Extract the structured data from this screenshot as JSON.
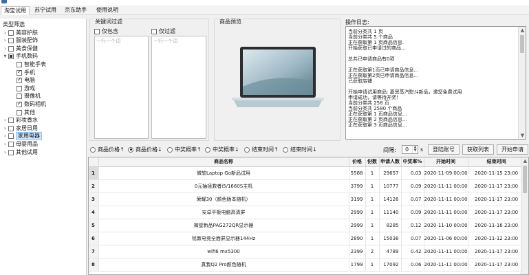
{
  "window": {
    "title": ""
  },
  "menu": {
    "tabs": [
      "淘宝试用",
      "苏宁试用",
      "京东助手",
      "使用说明"
    ]
  },
  "sidebar": {
    "title": "类型筛选",
    "items": [
      {
        "label": "美容护肤",
        "level": 0,
        "expander": ">",
        "state": "unchecked"
      },
      {
        "label": "服装配饰",
        "level": 0,
        "expander": ">",
        "state": "unchecked"
      },
      {
        "label": "美食保健",
        "level": 0,
        "expander": ">",
        "state": "unchecked"
      },
      {
        "label": "手机数码",
        "level": 0,
        "expander": "v",
        "state": "partial"
      },
      {
        "label": "智能手表",
        "level": 1,
        "expander": "",
        "state": "unchecked"
      },
      {
        "label": "手机",
        "level": 1,
        "expander": "",
        "state": "checked"
      },
      {
        "label": "电脑",
        "level": 1,
        "expander": "",
        "state": "checked"
      },
      {
        "label": "游戏",
        "level": 1,
        "expander": "",
        "state": "unchecked"
      },
      {
        "label": "摄像机",
        "level": 1,
        "expander": "",
        "state": "unchecked"
      },
      {
        "label": "数码相机",
        "level": 1,
        "expander": "",
        "state": "checked"
      },
      {
        "label": "其他",
        "level": 1,
        "expander": "",
        "state": "unchecked"
      },
      {
        "label": "彩妆香水",
        "level": 0,
        "expander": ">",
        "state": "unchecked"
      },
      {
        "label": "家居日用",
        "level": 0,
        "expander": ">",
        "state": "unchecked"
      },
      {
        "label": "家用电器",
        "level": 0,
        "expander": ">",
        "state": "unchecked",
        "selected": true
      },
      {
        "label": "母婴用品",
        "level": 0,
        "expander": ">",
        "state": "unchecked"
      },
      {
        "label": "其他试用",
        "level": 0,
        "expander": ">",
        "state": "unchecked"
      }
    ]
  },
  "filter": {
    "title": "关键词过滤",
    "include_label": "仅包含",
    "exclude_label": "仅过滤",
    "include_placeholder": "一行一个词",
    "exclude_placeholder": "一行一个词"
  },
  "preview": {
    "title": "商品预览"
  },
  "log": {
    "title": "操作日志:",
    "lines": [
      "当前分类共 1 页",
      "当前分类共 5 个商品",
      "正在获取第 1 页商品信息.",
      "开始获取已申请过的商品...",
      "",
      "总共已申请商品有0项",
      "",
      "正在获取第1页已申请商品信息...",
      "正在获取第2页已申请商品信息...",
      "已获取店铺",
      "",
      "开始申请试用商品: 嘉思蒸汽熨斗新品，邀您免费试用",
      "申请成功，请等待开奖！",
      "当前分类共 258 页",
      "当前分类共 2580 个商品",
      "正在获取第 1 页商品信息...",
      "正在获取第 2 页商品信息...",
      "正在获取第 3 页商品信息..."
    ]
  },
  "sort": {
    "options": [
      "商品价格↑",
      "商品价格↓",
      "中奖概率↑",
      "中奖概率↓",
      "结束时间↑",
      "结束时间↓"
    ],
    "selected_index": 1,
    "interval_label": "间隔:",
    "interval_value": "0",
    "interval_unit": "s",
    "buttons": {
      "tag": "登陆账号",
      "fetch": "获取列表",
      "apply": "开始申请"
    }
  },
  "table": {
    "columns": [
      "商品名称",
      "价格",
      "份数",
      "申请人数",
      "中奖率%",
      "开始时间",
      "结束时间"
    ],
    "rows": [
      {
        "n": "1",
        "name": "微软Laptop Go新品试用",
        "price": "5588",
        "qty": "1",
        "applicants": "29657",
        "rate": "0.03",
        "start": "2020-11-09 00:00",
        "end": "2020-11-15 23:00"
      },
      {
        "n": "2",
        "name": "0元抽拯救者i5/1660S主机",
        "price": "3799",
        "qty": "1",
        "applicants": "10777",
        "rate": "0.09",
        "start": "2020-11-11 00:00",
        "end": "2020-11-17 23:00"
      },
      {
        "n": "3",
        "name": "荣耀30（颜色版本随机）",
        "price": "3199",
        "qty": "1",
        "applicants": "14126",
        "rate": "0.07",
        "start": "2020-11-11 00:00",
        "end": "2020-11-17 23:00"
      },
      {
        "n": "4",
        "name": "安卓平板电脑高清屏",
        "price": "2999",
        "qty": "1",
        "applicants": "11140",
        "rate": "0.09",
        "start": "2020-11-11 00:00",
        "end": "2020-11-17 23:00"
      },
      {
        "n": "5",
        "name": "微星新品PAG272QR显示器",
        "price": "2999",
        "qty": "1",
        "applicants": "8285",
        "rate": "0.12",
        "start": "2020-11-10 00:00",
        "end": "2020-11-16 23:00"
      },
      {
        "n": "6",
        "name": "铭敦电竞全面屏显示器144Hz",
        "price": "2890",
        "qty": "1",
        "applicants": "15038",
        "rate": "0.07",
        "start": "2020-11-06 00:00",
        "end": "2020-11-12 23:00"
      },
      {
        "n": "7",
        "name": "wifi6 mx5300",
        "price": "2399",
        "qty": "2",
        "applicants": "4789",
        "rate": "0.42",
        "start": "2020-11-11 00:00",
        "end": "2020-11-17 23:00"
      },
      {
        "n": "8",
        "name": "真我Q2 Pro颜色随机",
        "price": "1799",
        "qty": "1",
        "applicants": "17092",
        "rate": "0.06",
        "start": "2020-11-11 00:00",
        "end": "2020-11-17 23:00"
      }
    ]
  }
}
